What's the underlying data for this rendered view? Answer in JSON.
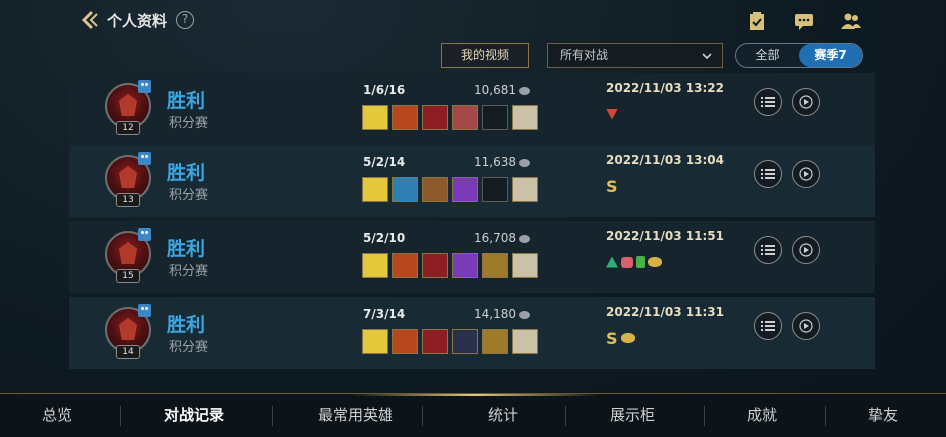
{
  "header": {
    "title": "个人资料",
    "help": "?"
  },
  "filters": {
    "my_videos": "我的视频",
    "match_filter": "所有对战",
    "seg_all": "全部",
    "seg_season": "赛季7"
  },
  "matches": [
    {
      "result": "胜利",
      "mode": "积分赛",
      "level": "12",
      "kda": "1/6/16",
      "gold": "10,681",
      "time": "2022/11/03 13:22"
    },
    {
      "result": "胜利",
      "mode": "积分赛",
      "level": "13",
      "kda": "5/2/14",
      "gold": "11,638",
      "time": "2022/11/03 13:04",
      "grade": "S"
    },
    {
      "result": "胜利",
      "mode": "积分赛",
      "level": "15",
      "kda": "5/2/10",
      "gold": "16,708",
      "time": "2022/11/03 11:51"
    },
    {
      "result": "胜利",
      "mode": "积分赛",
      "level": "14",
      "kda": "7/3/14",
      "gold": "14,180",
      "time": "2022/11/03 11:31",
      "grade": "S"
    }
  ],
  "nav": [
    "总览",
    "对战记录",
    "最常用英雄",
    "统计",
    "展示柜",
    "成就",
    "挚友"
  ],
  "colors": {
    "accent": "#3aa7e3",
    "gold": "#c9a45a",
    "active_tab": "#1f6fb2"
  }
}
